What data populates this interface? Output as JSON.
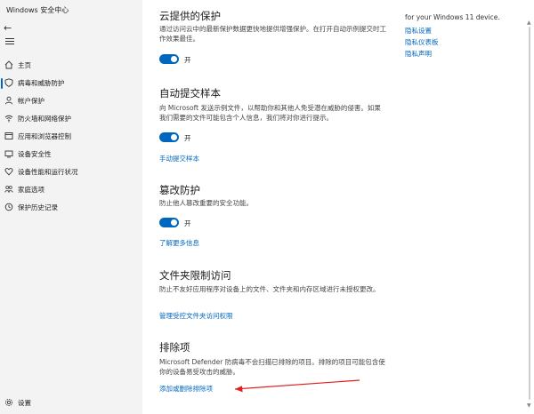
{
  "window": {
    "title": "Windows 安全中心"
  },
  "sidebar": {
    "back_icon": "back-arrow-icon",
    "menu_icon": "hamburger-icon",
    "items": [
      {
        "label": "主页",
        "icon": "home-icon"
      },
      {
        "label": "病毒和威胁防护",
        "icon": "shield-icon",
        "active": true
      },
      {
        "label": "帐户保护",
        "icon": "person-icon"
      },
      {
        "label": "防火墙和网络保护",
        "icon": "wifi-icon"
      },
      {
        "label": "应用和浏览器控制",
        "icon": "app-window-icon"
      },
      {
        "label": "设备安全性",
        "icon": "device-icon"
      },
      {
        "label": "设备性能和运行状况",
        "icon": "heart-icon"
      },
      {
        "label": "家庭选项",
        "icon": "family-icon"
      },
      {
        "label": "保护历史记录",
        "icon": "history-icon"
      }
    ],
    "settings": {
      "label": "设置",
      "icon": "gear-icon"
    }
  },
  "main": {
    "cloud_protection": {
      "title": "云提供的保护",
      "desc": "通过访问云中的最新保护数据更快地提供增强保护。在打开自动示例提交时工作效果最佳。",
      "toggle_state": "开"
    },
    "auto_sample": {
      "title": "自动提交样本",
      "desc": "向 Microsoft 发送示例文件，以帮助你和其他人免受潜在威胁的侵害。如果我们需要的文件可能包含个人信息，我们将对你进行提示。",
      "toggle_state": "开",
      "link": "手动提交样本"
    },
    "tamper": {
      "title": "篡改防护",
      "desc": "防止他人篡改重要的安全功能。",
      "toggle_state": "开",
      "link": "了解更多信息"
    },
    "folder_access": {
      "title": "文件夹限制访问",
      "desc": "防止不友好应用程序对设备上的文件、文件夹和内存区域进行未授权更改。",
      "link": "管理受控文件夹访问权限"
    },
    "exclusions": {
      "title": "排除项",
      "desc": "Microsoft Defender 防病毒不会扫描已排除的项目。排除的项目可能包含使你的设备易受攻击的威胁。",
      "link": "添加或删除排除项"
    }
  },
  "right_panel": {
    "text": "for your Windows 11 device.",
    "links": [
      "隐私设置",
      "隐私仪表板",
      "隐私声明"
    ]
  },
  "colors": {
    "accent": "#0067c0",
    "annotation_arrow": "#e02020"
  }
}
